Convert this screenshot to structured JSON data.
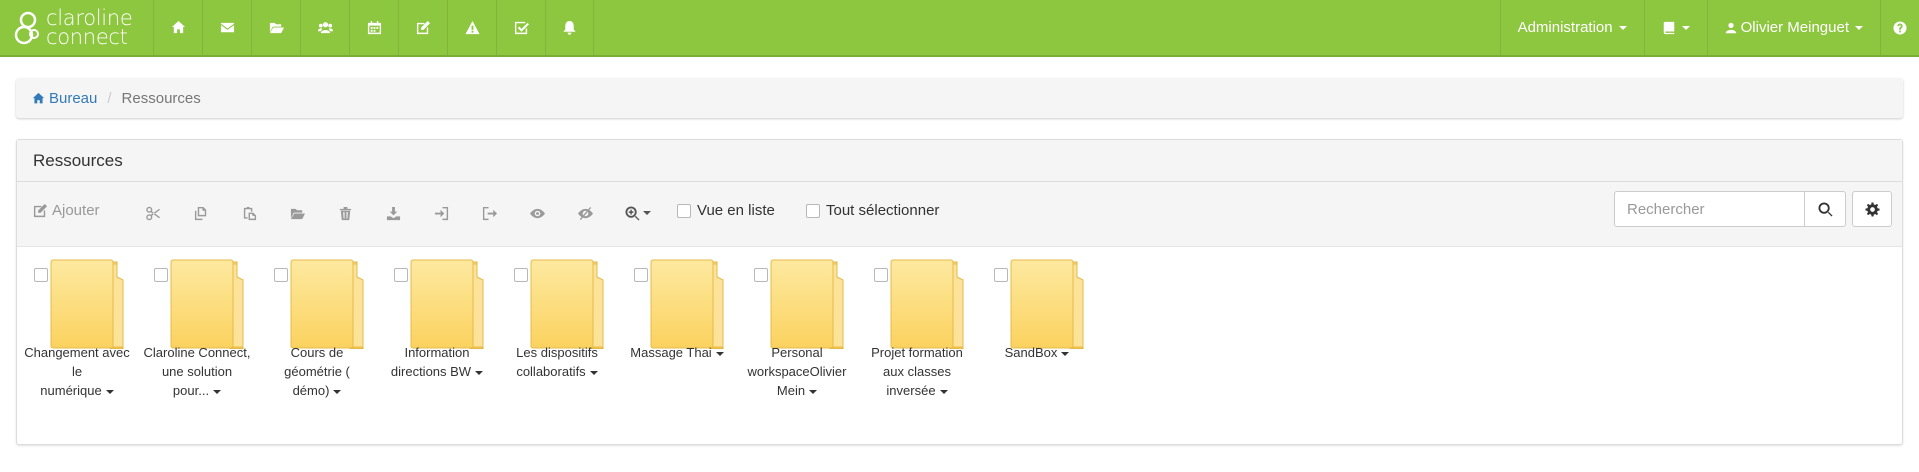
{
  "brand": {
    "line1": "claroline",
    "line2": "connect"
  },
  "nav_icons": [
    "home-icon",
    "envelope-icon",
    "folder-open-icon",
    "users-icon",
    "calendar-icon",
    "edit-icon",
    "warning-icon",
    "check-square-icon",
    "bell-icon"
  ],
  "nav_right": {
    "administration": "Administration",
    "user": "Olivier Meinguet"
  },
  "breadcrumb": {
    "home": "Bureau",
    "current": "Ressources"
  },
  "panel": {
    "title": "Ressources"
  },
  "toolbar": {
    "add": "Ajouter",
    "icons": [
      "cut-icon",
      "copy-icon",
      "paste-icon",
      "open-folder-icon",
      "trash-icon",
      "download-icon",
      "sign-in-icon",
      "sign-out-icon",
      "eye-icon",
      "eye-slash-icon"
    ],
    "list_view": "Vue en liste",
    "select_all": "Tout sélectionner"
  },
  "search": {
    "placeholder": "Rechercher"
  },
  "resources": [
    {
      "lines": [
        "Changement avec",
        "le",
        "numérique"
      ]
    },
    {
      "lines": [
        "Claroline Connect,",
        "une solution",
        "pour..."
      ]
    },
    {
      "lines": [
        "Cours de",
        "géométrie (",
        "démo)"
      ]
    },
    {
      "lines": [
        "Information",
        "directions BW"
      ]
    },
    {
      "lines": [
        "Les dispositifs",
        "collaboratifs"
      ]
    },
    {
      "lines": [
        "Massage Thai"
      ]
    },
    {
      "lines": [
        "Personal",
        "workspaceOlivier",
        "Mein"
      ]
    },
    {
      "lines": [
        "Projet formation",
        "aux classes",
        "inversée"
      ]
    },
    {
      "lines": [
        "SandBox"
      ]
    }
  ],
  "colors": {
    "navbar": "#8dc63f",
    "link": "#337ab7",
    "folder_front": "#fcd86b",
    "folder_back": "#f4c94e"
  }
}
